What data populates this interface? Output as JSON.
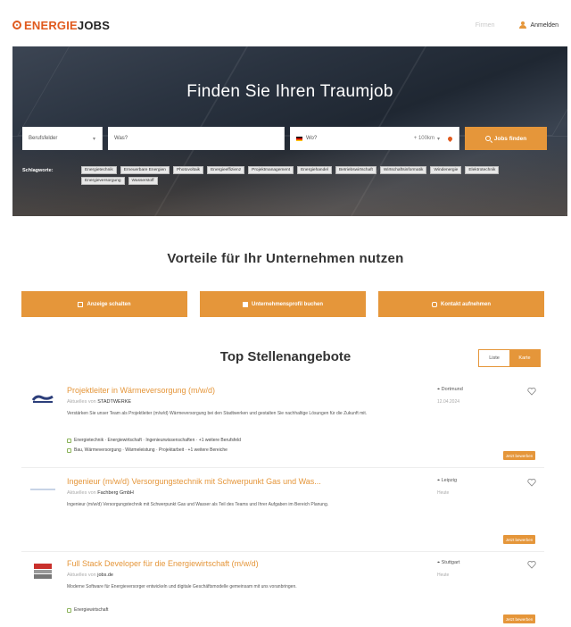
{
  "header": {
    "logo_energie": "ENERGIE",
    "logo_jobs": "JOBS",
    "link_muted": "Firmen",
    "login_label": "Anmelden"
  },
  "hero": {
    "title": "Finden Sie Ihren Traumjob",
    "category_placeholder": "Berufsfelder",
    "what_placeholder": "Was?",
    "where_placeholder": "Wo?",
    "radius": "+ 100km",
    "search_button": "Jobs finden",
    "keywords_label": "Schlagworte:",
    "keywords": [
      "Energietechnik",
      "Erneuerbare Energien",
      "Photovoltaik",
      "Energieeffizienz",
      "Projektmanagement",
      "Energiehandel",
      "Betriebswirtschaft",
      "Wirtschaftsinformatik",
      "Windenergie",
      "Elektrotechnik",
      "Energieversorgung",
      "Wasserstoff"
    ]
  },
  "vorteile": {
    "title": "Vorteile für Ihr Unternehmen nutzen",
    "buttons": [
      "Anzeige schalten",
      "Unternehmensprofil buchen",
      "Kontakt aufnehmen"
    ]
  },
  "top": {
    "title": "Top Stellenangebote",
    "toggle_list": "Liste",
    "toggle_map": "Karte"
  },
  "jobs": [
    {
      "title": "Projektleiter in Wärmeversorgung (m/w/d)",
      "company_prefix": "Aktuelles von",
      "company": "STADTWERKE",
      "desc": "Verstärken Sie unser Team als Projektleiter (m/w/d) Wärmeversorgung bei den Stadtwerken und gestalten Sie nachhaltige Lösungen für die Zukunft mit.",
      "tags1": "Energietechnik · Energiewirtschaft · Ingenieurwissenschaften · +1 weitere Berufsfeld",
      "tags2": "Bau, Wärmeversorgung · Wärmeleistung · Projektarbeit · +1 weitere Bereiche",
      "location": "Dortmund",
      "date": "12.04.2024",
      "apply": "Jetzt bewerben"
    },
    {
      "title": "Ingenieur (m/w/d) Versorgungstechnik mit Schwerpunkt Gas und Was...",
      "company_prefix": "Aktuelles von",
      "company": "Fachberg GmbH",
      "desc": "Ingenieur (m/w/d) Versorgungstechnik mit Schwerpunkt Gas und Wasser als Teil des Teams und Ihrer Aufgaben im Bereich Planung.",
      "tags1": "",
      "tags2": "",
      "location": "Leipzig",
      "date": "Heute",
      "apply": "Jetzt bewerben"
    },
    {
      "title": "Full Stack Developer für die Energiewirtschaft (m/w/d)",
      "company_prefix": "Aktuelles von",
      "company": "jobs.de",
      "desc": "Moderne Software für Energieversorger entwickeln und digitale Geschäftsmodelle gemeinsam mit uns voranbringen.",
      "tags1": "Energiewirtschaft",
      "tags2": "",
      "location": "Stuttgart",
      "date": "Heute",
      "apply": "Jetzt bewerben"
    }
  ],
  "colors": {
    "accent": "#e5963a",
    "brand": "#e05a1e"
  }
}
